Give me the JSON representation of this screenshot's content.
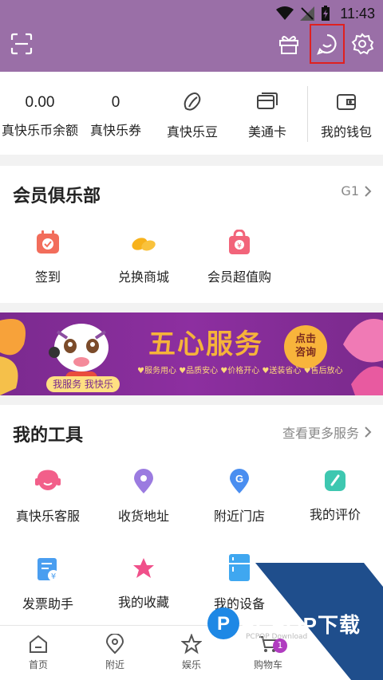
{
  "status": {
    "time": "11:43"
  },
  "header": {
    "icons": [
      "scan-icon",
      "gift-icon",
      "message-icon",
      "settings-icon"
    ]
  },
  "wallet": {
    "items": [
      {
        "value": "0.00",
        "label": "真快乐币余额"
      },
      {
        "value": "0",
        "label": "真快乐券"
      },
      {
        "icon": "bean-icon",
        "label": "真快乐豆"
      },
      {
        "icon": "card-icon",
        "label": "美通卡"
      },
      {
        "icon": "wallet-icon",
        "label": "我的钱包"
      }
    ]
  },
  "club": {
    "title": "会员俱乐部",
    "level": "G1",
    "items": [
      {
        "label": "签到",
        "icon": "calendar-checkin-icon"
      },
      {
        "label": "兑换商城",
        "icon": "beans-exchange-icon"
      },
      {
        "label": "会员超值购",
        "icon": "shopping-bag-icon"
      }
    ]
  },
  "banner": {
    "title": "五心服务",
    "slogan": "我服务 我快乐",
    "button": "点击\n咨询",
    "subs": "♥服务用心  ♥品质安心  ♥价格开心  ♥送装省心  ♥售后放心"
  },
  "tools": {
    "title": "我的工具",
    "more": "查看更多服务",
    "items": [
      {
        "label": "真快乐客服",
        "icon": "headset-icon"
      },
      {
        "label": "收货地址",
        "icon": "location-pin-icon"
      },
      {
        "label": "附近门店",
        "icon": "store-pin-icon"
      },
      {
        "label": "我的评价",
        "icon": "review-icon"
      },
      {
        "label": "发票助手",
        "icon": "invoice-icon"
      },
      {
        "label": "我的收藏",
        "icon": "star-icon"
      },
      {
        "label": "我的设备",
        "icon": "fridge-icon"
      }
    ]
  },
  "nav": {
    "items": [
      {
        "label": "首页",
        "icon": "home-icon"
      },
      {
        "label": "附近",
        "icon": "nearby-icon"
      },
      {
        "label": "娱乐",
        "icon": "entertainment-star-icon"
      },
      {
        "label": "购物车",
        "icon": "cart-icon",
        "badge": "1"
      }
    ]
  },
  "watermark": {
    "text": "PCPOP下载",
    "small": "PCPOP Download"
  },
  "colors": {
    "header": "#9a6fa7",
    "accent": "#b03cc0",
    "highlight": "#e02020"
  }
}
